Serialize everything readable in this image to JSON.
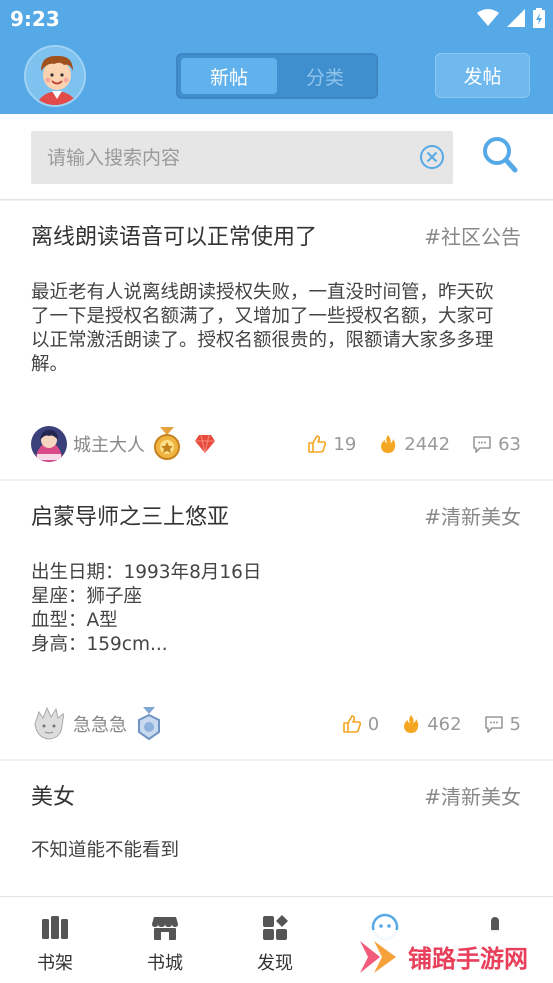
{
  "status_bar": {
    "time": "9:23"
  },
  "header": {
    "segments": [
      {
        "label": "新帖",
        "active": true
      },
      {
        "label": "分类",
        "active": false
      }
    ],
    "post_button": "发帖"
  },
  "search": {
    "placeholder": "请输入搜索内容",
    "value": ""
  },
  "posts": [
    {
      "title": "离线朗读语音可以正常使用了",
      "tag": "#社区公告",
      "body": "最近老有人说离线朗读授权失败，一直没时间管，昨天砍了一下是授权名额满了，又增加了一些授权名额，大家可以正常激活朗读了。授权名额很贵的，限额请大家多多理解。",
      "author": "城主大人",
      "likes": "19",
      "hot": "2442",
      "comments": "63"
    },
    {
      "title": "启蒙导师之三上悠亚",
      "tag": "#清新美女",
      "body_lines": [
        "出生日期：1993年8月16日",
        "星座：狮子座",
        "血型：A型",
        "身高：159cm..."
      ],
      "author": "急急急",
      "likes": "0",
      "hot": "462",
      "comments": "5"
    },
    {
      "title": "美女",
      "tag": "#清新美女",
      "body": "不知道能不能看到"
    }
  ],
  "tabbar": {
    "tabs": [
      {
        "label": "书架"
      },
      {
        "label": "书城"
      },
      {
        "label": "发现"
      }
    ]
  },
  "watermark": {
    "text": "铺路手游网"
  },
  "colors": {
    "primary": "#55a9e6",
    "accent_orange": "#f5a623",
    "watermark": "#e83f5a"
  }
}
